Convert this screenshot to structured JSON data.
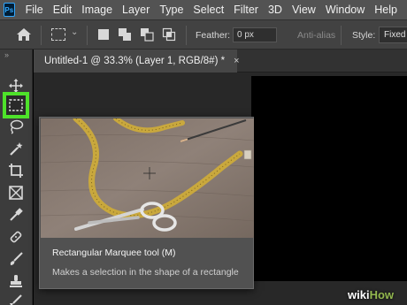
{
  "app": {
    "logo_text": "Ps"
  },
  "menu": [
    "File",
    "Edit",
    "Image",
    "Layer",
    "Type",
    "Select",
    "Filter",
    "3D",
    "View",
    "Window",
    "Help"
  ],
  "options": {
    "preset_chevron": "⌄",
    "feather_label": "Feather:",
    "feather_value": "0 px",
    "antialias_label": "Anti-alias",
    "style_label": "Style:",
    "style_value": "Fixed"
  },
  "toolbar": {
    "collapse_glyph": "»",
    "tools": [
      "move",
      "rectangular-marquee",
      "lasso",
      "quick-selection",
      "crop",
      "frame",
      "eyedropper",
      "spot-healing",
      "brush",
      "clone-stamp",
      "history-brush"
    ],
    "active_tool": "rectangular-marquee",
    "highlight_color": "#4ee22a"
  },
  "document": {
    "tab_title": "Untitled-1 @ 33.3% (Layer 1, RGB/8#) *",
    "tab_close": "×"
  },
  "tooltip": {
    "title": "Rectangular Marquee tool (M)",
    "description": "Makes a selection in the shape of a rectangle"
  },
  "watermark": {
    "wiki": "wiki",
    "how": "How"
  }
}
